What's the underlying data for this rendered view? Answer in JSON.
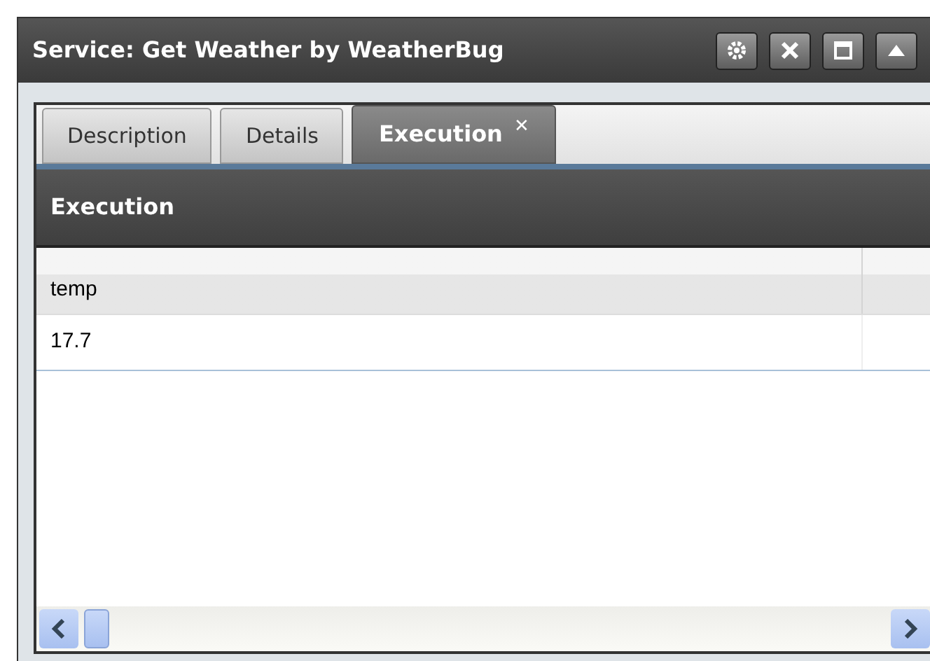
{
  "window": {
    "title": "Service: Get Weather by WeatherBug"
  },
  "tabs": [
    {
      "label": "Description",
      "selected": false
    },
    {
      "label": "Details",
      "selected": false
    },
    {
      "label": "Execution",
      "selected": true,
      "close_glyph": "✕"
    }
  ],
  "panel": {
    "title": "Execution"
  },
  "table": {
    "columns": [
      "temp"
    ],
    "rows": [
      [
        "17.7"
      ]
    ]
  }
}
